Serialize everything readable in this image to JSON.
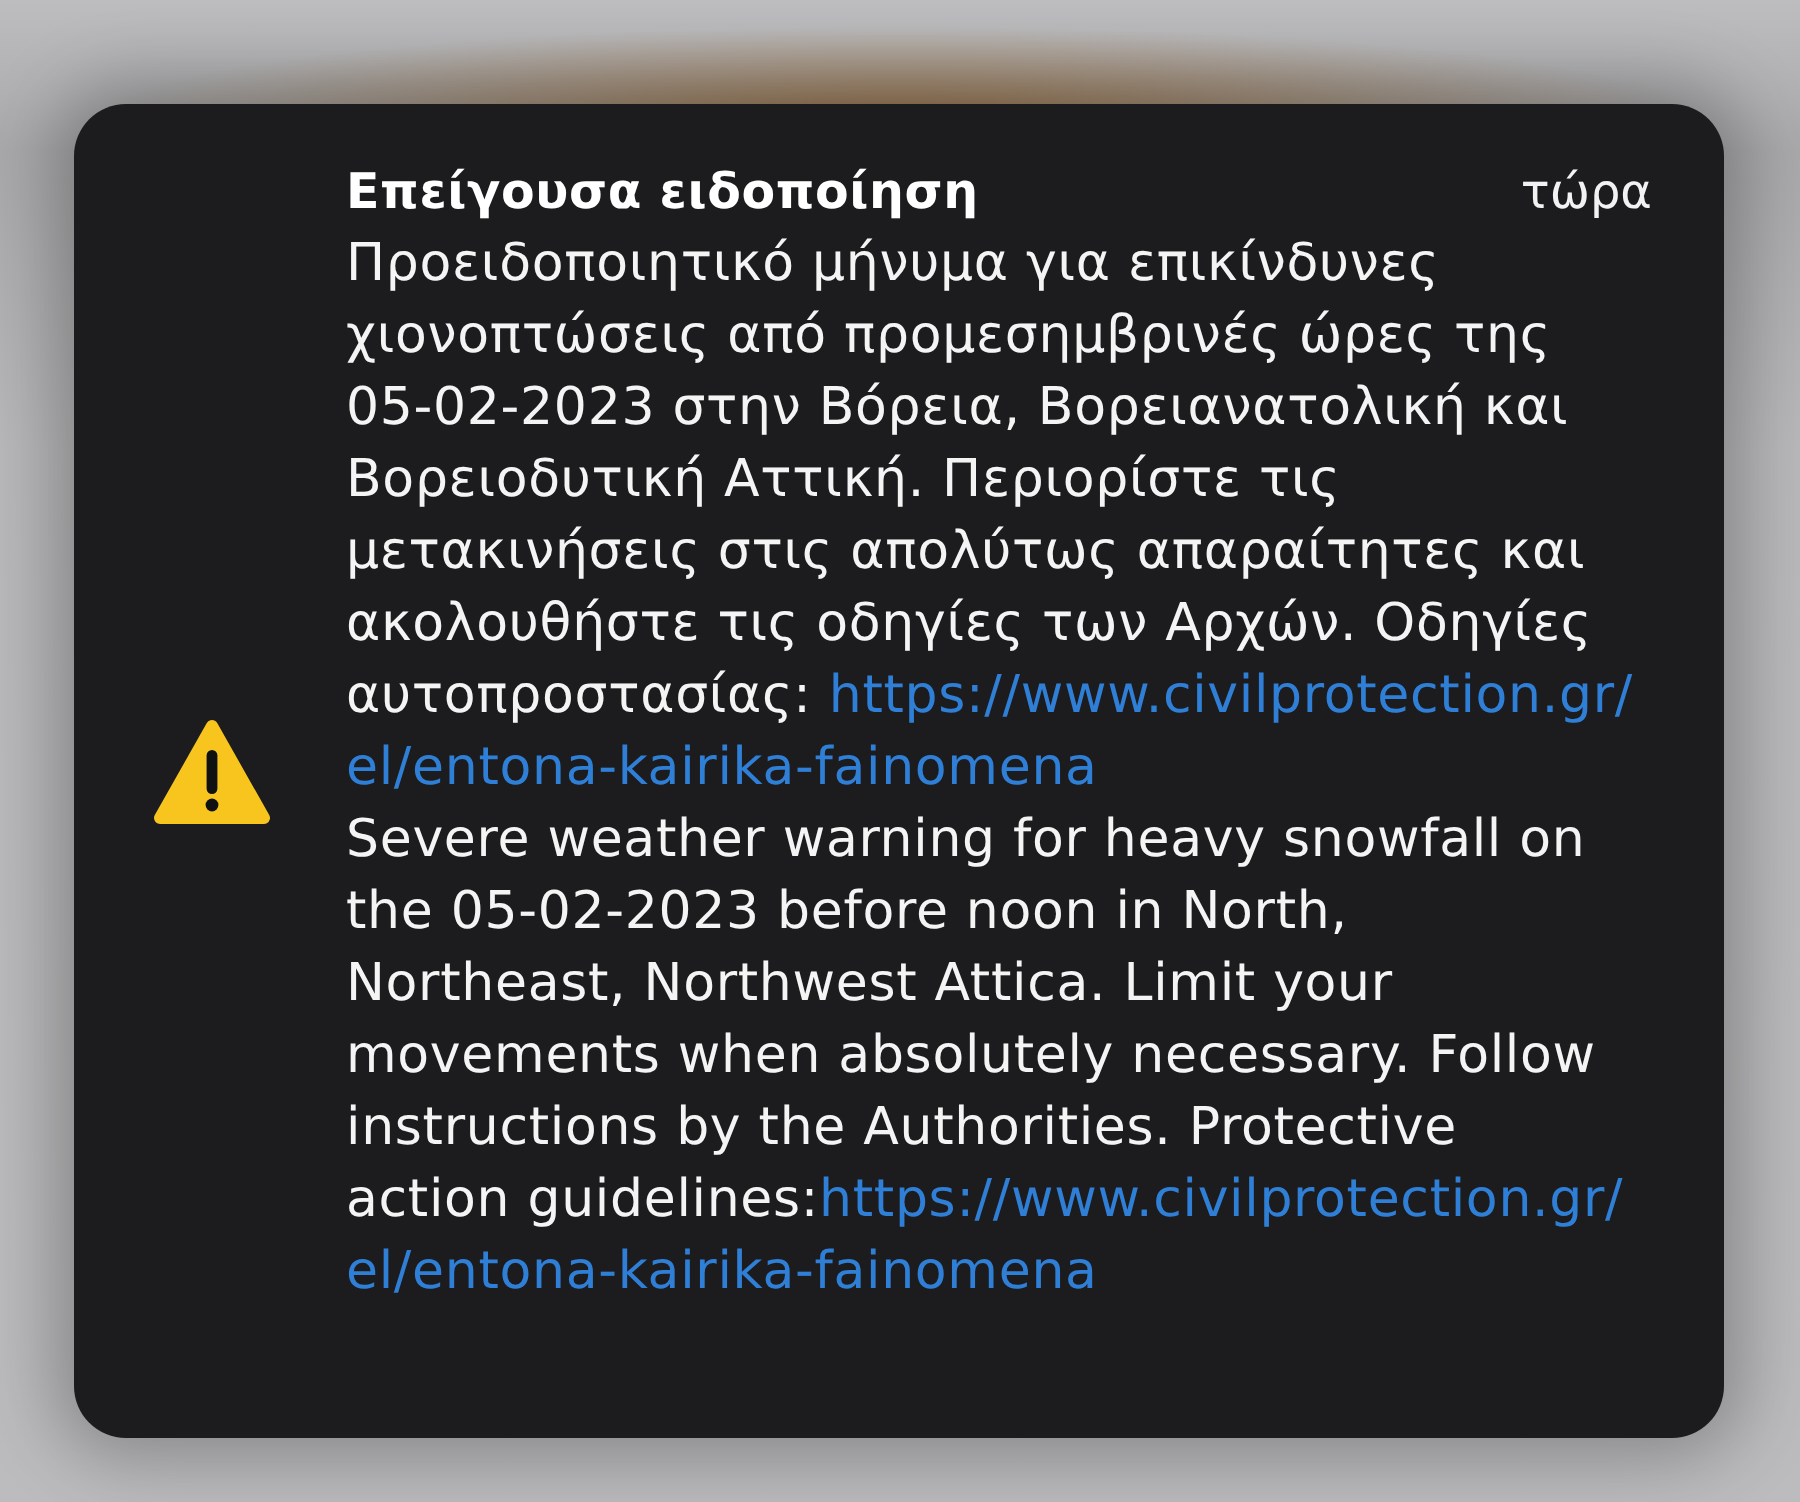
{
  "notification": {
    "title": "Επείγουσα ειδοποίηση",
    "time": "τώρα",
    "messages": [
      {
        "text": "Προειδοποιητικό μήνυμα για επικίνδυνες χιονοπτώσεις από προμεσημβρινές ώρες της 05-02-2023 στην Βόρεια, Βορειανατολική και Βορειοδυτική Αττική. Περιορίστε τις μετακινήσεις στις απολύτως απαραίτητες και ακολουθήστε τις οδηγίες των Αρχών. Οδηγίες αυτοπροστασίας: ",
        "link_parts": [
          "https://www.civilprotection.gr/",
          "el/entona-kairika-fainomena"
        ]
      },
      {
        "text": "Severe weather warning for heavy snowfall on the 05-02-2023 before noon in North, Northeast, Northwest Attica. Limit your movements when absolutely necessary. Follow instructions by the Authorities. Protective action guidelines:",
        "link_parts": [
          "https://www.civilprotection.gr/",
          "el/entona-kairika-fainomena"
        ]
      }
    ]
  }
}
